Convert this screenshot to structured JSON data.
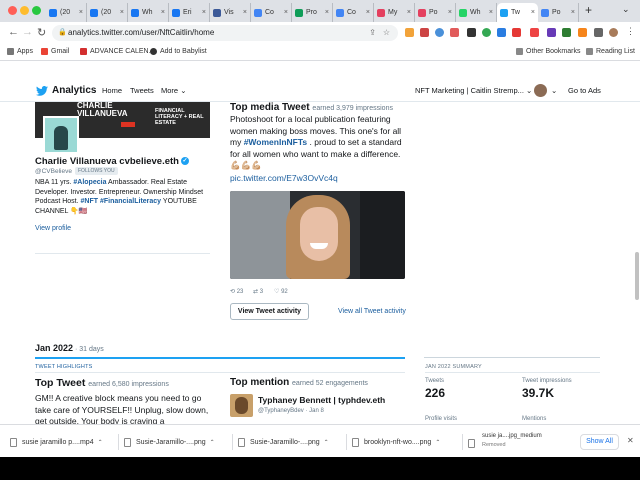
{
  "browser": {
    "tabs": [
      {
        "label": "(20",
        "color": "#1877f2"
      },
      {
        "label": "(20",
        "color": "#1877f2"
      },
      {
        "label": "Wh",
        "color": "#1877f2"
      },
      {
        "label": "Eri",
        "color": "#1877f2"
      },
      {
        "label": "Vis",
        "color": "#3b5998"
      },
      {
        "label": "Co",
        "color": "#4285f4"
      },
      {
        "label": "Pro",
        "color": "#0f9d58"
      },
      {
        "label": "Co",
        "color": "#4285f4"
      },
      {
        "label": "My",
        "color": "#e4405f"
      },
      {
        "label": "Po",
        "color": "#e4405f"
      },
      {
        "label": "Wh",
        "color": "#25d366"
      },
      {
        "label": "Tw",
        "color": "#1da1f2"
      },
      {
        "label": "Po",
        "color": "#4285f4"
      }
    ],
    "new_tab_icon": "+",
    "url": "analytics.twitter.com/user/NftCaitlin/home",
    "bookmarks": {
      "apps": "Apps",
      "gmail": "Gmail",
      "advance": "ADVANCE CALEN...",
      "babylist": "Add to Babylist",
      "other": "Other Bookmarks",
      "reading": "Reading List"
    }
  },
  "header": {
    "logo": "Analytics",
    "nav": {
      "home": "Home",
      "tweets": "Tweets",
      "more": "More"
    },
    "account": "NFT Marketing | Caitlin Stremp...",
    "go_to_ads": "Go to Ads"
  },
  "profile": {
    "banner_line1": "CHARLIE",
    "banner_line2": "VILLANUEVA",
    "banner_right": "FINANCIAL LITERACY + REAL ESTATE",
    "name": "Charlie Villanueva cvbelieve.eth",
    "handle": "@CVBelieve",
    "follows_badge": "FOLLOWS YOU",
    "bio_1": "NBA 11 yrs. ",
    "bio_tag1": "#Alopecia",
    "bio_2": " Ambassador. Real Estate Developer. Investor. Entrepreneur. Ownership Mindset Podcast Host. ",
    "bio_tag2": "#NFT",
    "bio_3": " ",
    "bio_tag3": "#FinancialLiteracy",
    "bio_4": " YOUTUBE CHANNEL 👇🇺🇸",
    "view_profile": "View profile"
  },
  "top_media": {
    "title": "Top media Tweet",
    "earned": "earned 3,979 impressions",
    "text_1": "Photoshoot for a local publication featuring women making boss moves. This one's for all my ",
    "tag": "#WomenInNFTs",
    "text_2": " . proud to set a standard for all women who want to make a difference. 💪🏼💪🏼💪🏼",
    "link": "pic.twitter.com/E7w3OvVc4q",
    "retweet_count": "23",
    "reply_count": "3",
    "like_count": "92",
    "view_activity": "View Tweet activity",
    "view_all": "View all Tweet activity"
  },
  "month": {
    "label": "Jan 2022",
    "days": " · 31 days",
    "highlights": "TWEET HIGHLIGHTS",
    "summary": "JAN 2022 SUMMARY"
  },
  "top_tweet": {
    "title": "Top Tweet",
    "earned": "earned 6,580 impressions",
    "text": "GM!! A creative block means you need to go take care of YOURSELF!! Unplug, slow down, get outside. Your body is craving a"
  },
  "top_mention": {
    "title": "Top mention",
    "earned": "earned 52 engagements",
    "name": "Typhaney Bennett | typhdev.eth",
    "handle": "@TyphaneyBdev · Jan 8"
  },
  "summary_stats": {
    "tweets_label": "Tweets",
    "tweets_value": "226",
    "impressions_label": "Tweet impressions",
    "impressions_value": "39.7K",
    "profile_visits_label": "Profile visits",
    "mentions_label": "Mentions"
  },
  "downloads": {
    "items": [
      "susie jaramillo p....mp4",
      "Susie-Jaramillo-....png",
      "Susie-Jaramillo-....png",
      "brooklyn-nft-wo....png"
    ],
    "removed_name": "susie ja....jpg_medium",
    "removed_status": "Removed",
    "show_all": "Show All"
  },
  "colors": {
    "twitter_blue": "#1da1f2",
    "link_blue": "#1b5e9e"
  }
}
